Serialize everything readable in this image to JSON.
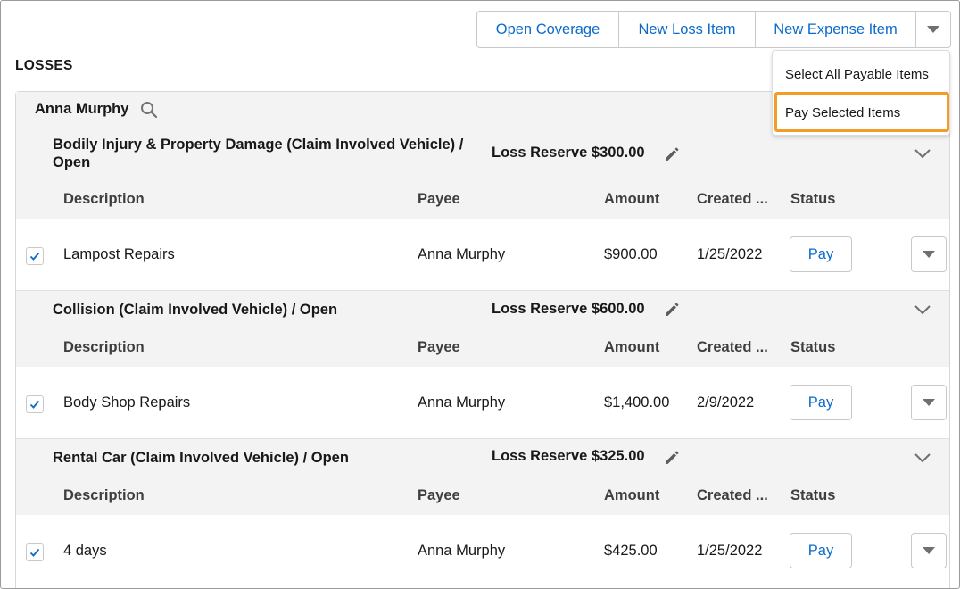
{
  "toolbar": {
    "open_coverage": "Open Coverage",
    "new_loss_item": "New Loss Item",
    "new_expense_item": "New Expense Item"
  },
  "dropdown": {
    "items": [
      "Select All Payable Items",
      "Pay Selected Items"
    ],
    "highlighted_item": "Pay Selected Items",
    "highlight_color": "#f39c28"
  },
  "section": {
    "title": "LOSSES"
  },
  "claimant": {
    "name": "Anna Murphy"
  },
  "columns": [
    "Description",
    "Payee",
    "Amount",
    "Created ...",
    "Status"
  ],
  "coverages": [
    {
      "title_line1": "Bodily Injury & Property Damage (Claim Involved Vehicle) /",
      "title_line2": "Open",
      "reserve": "Loss Reserve $300.00",
      "items": [
        {
          "description": "Lampost Repairs",
          "payee": "Anna Murphy",
          "amount": "$900.00",
          "created": "1/25/2022",
          "status_action": "Pay",
          "checked": true
        }
      ]
    },
    {
      "title_line1": "Collision (Claim Involved Vehicle) / Open",
      "reserve": "Loss Reserve $600.00",
      "items": [
        {
          "description": "Body Shop Repairs",
          "payee": "Anna Murphy",
          "amount": "$1,400.00",
          "created": "2/9/2022",
          "status_action": "Pay",
          "checked": true
        }
      ]
    },
    {
      "title_line1": "Rental Car (Claim Involved Vehicle) / Open",
      "reserve": "Loss Reserve $325.00",
      "items": [
        {
          "description": "4 days",
          "payee": "Anna Murphy",
          "amount": "$425.00",
          "created": "1/25/2022",
          "status_action": "Pay",
          "checked": true
        }
      ]
    }
  ],
  "colors": {
    "link_blue": "#0b6bcb",
    "header_gray": "#f3f3f3",
    "border": "#c9c9c9"
  }
}
